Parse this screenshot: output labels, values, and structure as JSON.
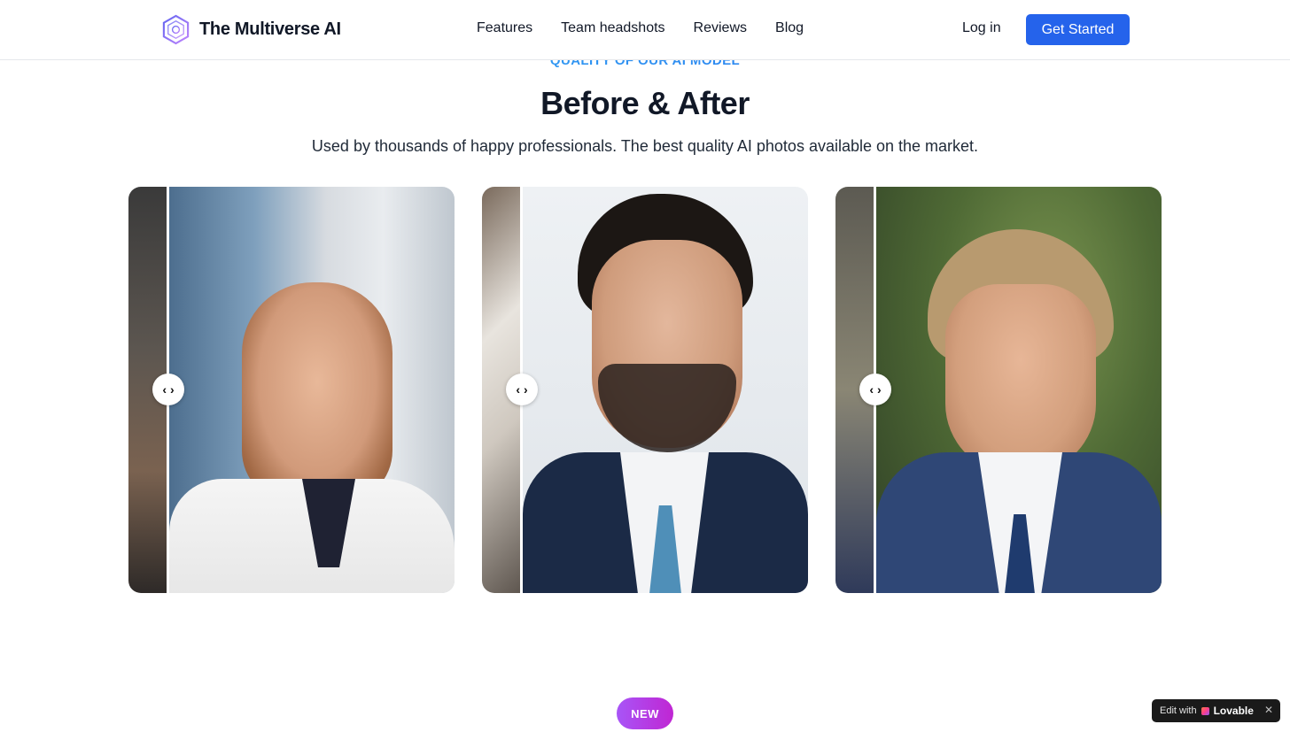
{
  "header": {
    "brand": "The Multiverse AI",
    "nav": [
      {
        "label": "Features"
      },
      {
        "label": "Team headshots"
      },
      {
        "label": "Reviews"
      },
      {
        "label": "Blog"
      }
    ],
    "login_label": "Log in",
    "cta_label": "Get Started"
  },
  "section": {
    "eyebrow": "QUALITY OF OUR AI MODEL",
    "title": "Before & After",
    "subtitle": "Used by thousands of happy professionals. The best quality AI photos available on the market."
  },
  "comparisons": [
    {
      "handle_glyph": "‹ ›"
    },
    {
      "handle_glyph": "‹ ›"
    },
    {
      "handle_glyph": "‹ ›"
    }
  ],
  "badge": {
    "label": "NEW"
  },
  "lovable": {
    "prefix": "Edit with",
    "brand": "Lovable",
    "close": "✕"
  },
  "colors": {
    "accent": "#2563eb",
    "badge": "#a855f7"
  },
  "icons": {
    "logo": "hexagon-logo-icon",
    "slider_handle": "left-right-arrows-icon",
    "close": "close-icon"
  }
}
